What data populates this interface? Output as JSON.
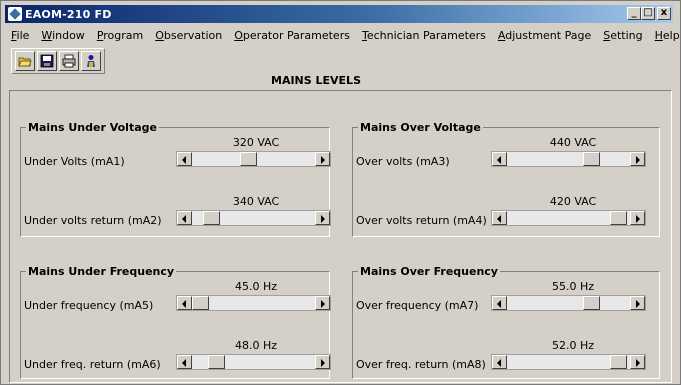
{
  "window": {
    "title": "EAOM-210 FD",
    "minimize": "_",
    "maximize": "□",
    "close": "x"
  },
  "menu": [
    {
      "first": "F",
      "rest": "ile"
    },
    {
      "first": "W",
      "rest": "indow"
    },
    {
      "first": "P",
      "rest": "rogram"
    },
    {
      "first": "O",
      "rest": "bservation"
    },
    {
      "first": "O",
      "rest": "perator Parameters"
    },
    {
      "first": "T",
      "rest": "echnician Parameters"
    },
    {
      "first": "A",
      "rest": "djustment Page"
    },
    {
      "first": "S",
      "rest": "etting"
    },
    {
      "first": "H",
      "rest": "elp"
    }
  ],
  "toolbar": {
    "icons": [
      "open-folder-icon",
      "save-disk-icon",
      "printer-icon",
      "user-icon"
    ]
  },
  "panel": {
    "title": "MAINS LEVELS"
  },
  "groups": {
    "under_voltage": {
      "title": "Mains Under Voltage",
      "params": [
        {
          "label": "Under Volts (mA1)",
          "value": "320 VAC",
          "position": 0.45
        },
        {
          "label": "Under volts return (mA2)",
          "value": "340 VAC",
          "position": 0.1
        }
      ]
    },
    "over_voltage": {
      "title": "Mains Over Voltage",
      "params": [
        {
          "label": "Over volts (mA3)",
          "value": "440 VAC",
          "position": 0.72
        },
        {
          "label": "Over volts return (mA4)",
          "value": "420 VAC",
          "position": 0.97
        }
      ]
    },
    "under_frequency": {
      "title": "Mains Under Frequency",
      "params": [
        {
          "label": "Under frequency (mA5)",
          "value": "45.0 Hz",
          "position": 0.0
        },
        {
          "label": "Under freq. return (mA6)",
          "value": "48.0 Hz",
          "position": 0.15
        }
      ]
    },
    "over_frequency": {
      "title": "Mains Over Frequency",
      "params": [
        {
          "label": "Over frequency (mA7)",
          "value": "55.0 Hz",
          "position": 0.72
        },
        {
          "label": "Over freq. return (mA8)",
          "value": "52.0 Hz",
          "position": 0.97
        }
      ]
    }
  }
}
